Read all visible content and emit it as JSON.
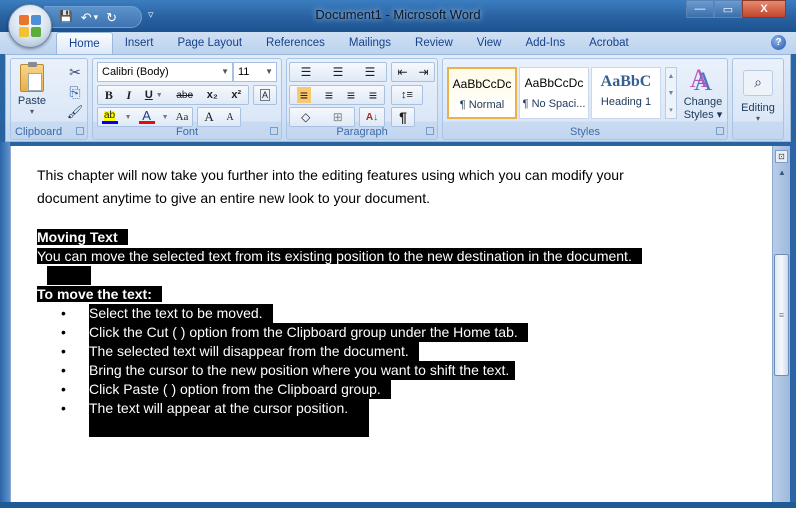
{
  "window": {
    "title": "Document1 - Microsoft Word",
    "controls": {
      "minimize": "—",
      "maximize": "▭",
      "close": "X"
    }
  },
  "qat": {
    "save_icon": "💾",
    "undo_icon": "↶",
    "undo_dropdown": "▾",
    "redo_icon": "↻",
    "customize": "▿"
  },
  "tabs": [
    {
      "label": "Home",
      "active": true
    },
    {
      "label": "Insert"
    },
    {
      "label": "Page Layout"
    },
    {
      "label": "References"
    },
    {
      "label": "Mailings"
    },
    {
      "label": "Review"
    },
    {
      "label": "View"
    },
    {
      "label": "Add-Ins"
    },
    {
      "label": "Acrobat"
    }
  ],
  "help_label": "?",
  "ribbon": {
    "clipboard": {
      "label": "Clipboard",
      "paste_label": "Paste",
      "paste_dropdown": "▾",
      "cut_icon": "✂",
      "copy_icon": "⎘",
      "format_painter_icon": "🖌"
    },
    "font": {
      "label": "Font",
      "font_name": "Calibri (Body)",
      "font_size": "11",
      "bold": "B",
      "italic": "I",
      "underline": "U",
      "strikethrough": "abe",
      "subscript": "x₂",
      "superscript": "x²",
      "clear_formatting": "A",
      "highlight": "ab",
      "font_color": "A",
      "change_case": "Aa",
      "grow_font": "A",
      "shrink_font": "A",
      "highlight_color": "#0000ff",
      "font_color_value": "#e01010"
    },
    "paragraph": {
      "label": "Paragraph",
      "bullets": "☰",
      "numbering": "☰",
      "multilevel": "☰",
      "decrease_indent": "⇤",
      "increase_indent": "⇥",
      "align_left": "≡",
      "center": "≡",
      "align_right": "≡",
      "justify": "≡",
      "line_spacing": "↕≡",
      "shading": "◇",
      "borders": "⊞",
      "sort": "A↓",
      "show_marks": "¶"
    },
    "styles": {
      "label": "Styles",
      "items": [
        {
          "sample": "AaBbCcDc",
          "name": "¶ Normal",
          "selected": true
        },
        {
          "sample": "AaBbCcDc",
          "name": "¶ No Spaci..."
        },
        {
          "sample": "AaBbC",
          "name": "Heading 1"
        }
      ],
      "change_styles_line1": "Change",
      "change_styles_line2": "Styles ▾",
      "change_styles_icon": "A"
    },
    "editing": {
      "label": "Editing",
      "dropdown": "▾",
      "icon": "⌕"
    }
  },
  "document": {
    "intro_line1": "This chapter will now take you further into the editing features using which you can modify your",
    "intro_line2": "document anytime to give an entire new look to your document.",
    "heading1": "Moving Text",
    "para1": "You can move the selected text from its existing position to the new destination in the document.",
    "heading2": "To move the text:",
    "bullet_glyph": "•",
    "steps": [
      "Select the text to be moved.",
      "Click the Cut ( ) option from the Clipboard group under the Home tab.",
      "The selected text will disappear from the  document.",
      "Bring the cursor to the new position where you want to shift the text.",
      "Click Paste ( ) option from the Clipboard group.",
      "The text will appear at the cursor position."
    ]
  },
  "scrollbar": {
    "ruler_toggle": "⊡",
    "up_arrow": "▲",
    "thumb_grip": "≡"
  }
}
